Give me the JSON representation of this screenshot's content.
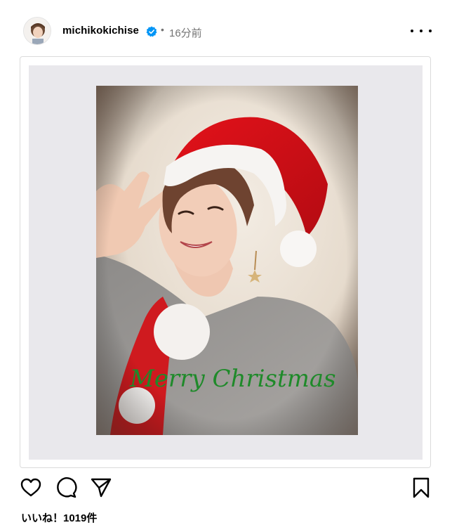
{
  "post": {
    "username": "michikokichise",
    "separator": "•",
    "time": "16分前",
    "likes_text": "いいね！1019件"
  },
  "image": {
    "caption": "Merry Christmas",
    "caption_color": "#1f8a2a"
  },
  "icons": {
    "verified": "verified-badge-icon",
    "more": "more-options-icon",
    "like": "heart-icon",
    "comment": "comment-icon",
    "share": "send-icon",
    "save": "bookmark-icon"
  },
  "colors": {
    "verified_blue": "#0095f6",
    "meta_gray": "#737373",
    "mat": "#e9e8ec"
  }
}
